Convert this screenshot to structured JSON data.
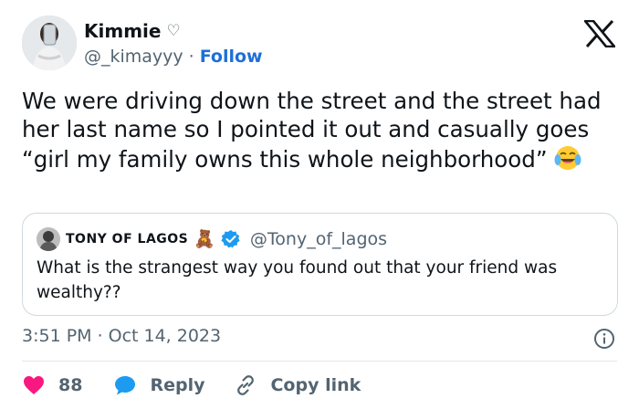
{
  "author": {
    "display_name": "Kimmie",
    "name_badge": "♡",
    "handle": "@_kimayyy",
    "separator": "·",
    "follow_label": "Follow"
  },
  "tweet": {
    "text": "We were driving down the street and the street had her last name so I pointed it out and casually goes “girl my family owns this whole neighborhood”",
    "emoji": "😂"
  },
  "quote": {
    "name": "TONY OF LAGOS",
    "name_emoji": "🧸",
    "handle": "@Tony_of_lagos",
    "text": "What is the strangest way you found out that your friend was wealthy??"
  },
  "meta": {
    "time": "3:51 PM",
    "separator": "·",
    "date": "Oct 14, 2023"
  },
  "actions": {
    "like_count": "88",
    "reply_label": "Reply",
    "copy_label": "Copy link"
  },
  "colors": {
    "link_blue": "#1d6fd8",
    "like_red": "#f91880",
    "muted": "#536471",
    "verified_blue": "#1d9bf0"
  }
}
